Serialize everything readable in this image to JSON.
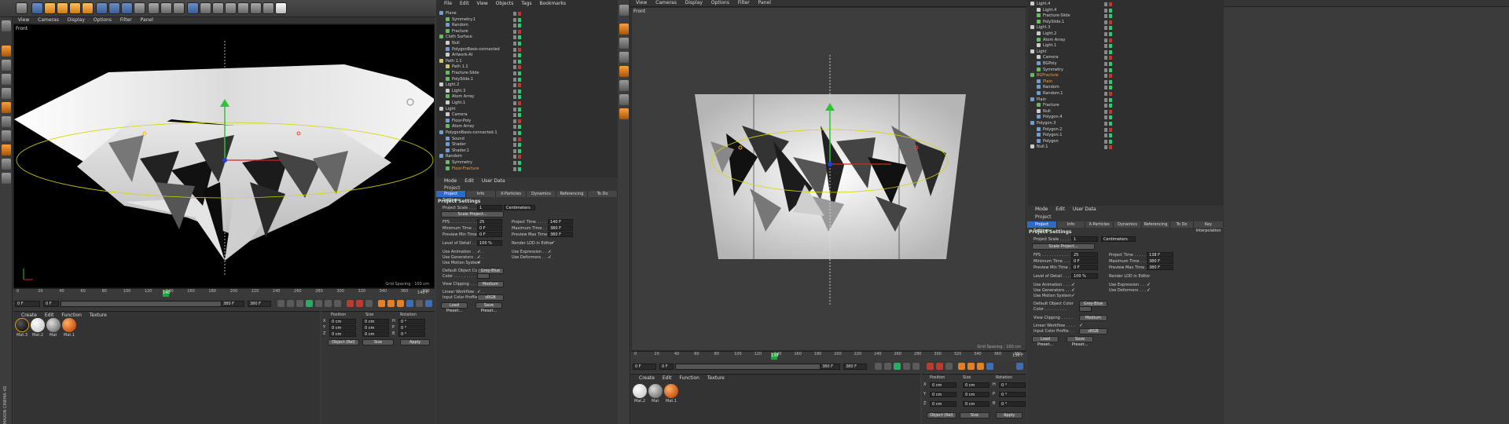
{
  "left": {
    "viewport_menu": [
      "View",
      "Cameras",
      "Display",
      "Options",
      "Filter",
      "Panel"
    ],
    "viewport_label": "Front",
    "grid_spacing": "Grid Spacing : 100 cm",
    "timeline_ticks": [
      "0",
      "20",
      "40",
      "60",
      "80",
      "100",
      "120",
      "140",
      "160",
      "180",
      "200",
      "220",
      "240",
      "260",
      "280",
      "300",
      "320",
      "340",
      "360",
      "380"
    ],
    "playhead": "140",
    "frame_end": "140 F",
    "frame_start_field": "0 F",
    "frame_min_field": "0 F",
    "frame_range_end": "380 F",
    "frame_max_field": "380 F",
    "objects_menu": [
      "File",
      "Edit",
      "View",
      "Objects",
      "Tags",
      "Bookmarks"
    ],
    "objects": [
      {
        "name": "Plane",
        "icon": "b",
        "orange": false
      },
      {
        "name": "Symmetry.1",
        "icon": "g",
        "orange": false
      },
      {
        "name": "Random",
        "icon": "b",
        "orange": false
      },
      {
        "name": "Fracture",
        "icon": "g",
        "orange": false
      },
      {
        "name": "Cloth Surface",
        "icon": "g",
        "orange": false
      },
      {
        "name": "Null",
        "icon": "w",
        "orange": false
      },
      {
        "name": "PolygonBasis-connected",
        "icon": "b",
        "orange": false
      },
      {
        "name": "Artwork-AI",
        "icon": "w",
        "orange": false
      },
      {
        "name": "Path 1.1",
        "icon": "y",
        "orange": false
      },
      {
        "name": "Path 1.1",
        "icon": "y",
        "orange": false
      },
      {
        "name": "Fracture-Slide",
        "icon": "g",
        "orange": false
      },
      {
        "name": "PolySlide.1",
        "icon": "g",
        "orange": false
      },
      {
        "name": "Light.2",
        "icon": "w",
        "orange": false
      },
      {
        "name": "Light.3",
        "icon": "w",
        "orange": false
      },
      {
        "name": "Atom Array",
        "icon": "g",
        "orange": false
      },
      {
        "name": "Light.1",
        "icon": "w",
        "orange": false
      },
      {
        "name": "Light",
        "icon": "w",
        "orange": false
      },
      {
        "name": "Camera",
        "icon": "w",
        "orange": false
      },
      {
        "name": "Floor-Poly",
        "icon": "b",
        "orange": false
      },
      {
        "name": "Atom Array",
        "icon": "g",
        "orange": false
      },
      {
        "name": "PolygonBasis-connected.1",
        "icon": "b",
        "orange": false
      },
      {
        "name": "Sound",
        "icon": "b",
        "orange": false
      },
      {
        "name": "Shader",
        "icon": "b",
        "orange": false
      },
      {
        "name": "Shader.1",
        "icon": "b",
        "orange": false
      },
      {
        "name": "Random",
        "icon": "b",
        "orange": false
      },
      {
        "name": "Symmetry",
        "icon": "g",
        "orange": false
      },
      {
        "name": "Floor-Fracture",
        "icon": "g",
        "orange": true
      }
    ],
    "attr_menu": [
      "Mode",
      "Edit",
      "User Data"
    ],
    "attr_title": "Project",
    "attr_tabs": [
      "Project Settings",
      "Info",
      "X-Particles",
      "Dynamics",
      "Referencing",
      "To Do"
    ],
    "section": "Project Settings",
    "project_scale_label": "Project Scale . . . . .",
    "project_scale_value": "1",
    "project_scale_unit": "Centimeters",
    "scale_project_btn": "Scale Project...",
    "fps_label": "FPS . . . . . . . . . . .",
    "fps": "25",
    "project_time_label": "Project Time . . . . .",
    "project_time": "140 F",
    "min_time_label": "Minimum Time . . . .",
    "min_time": "0 F",
    "max_time_label": "Maximum Time . . .",
    "max_time": "380 F",
    "pmin_label": "Preview Min Time . .",
    "pmin": "0 F",
    "pmax_label": "Preview Max Time .",
    "pmax": "380 F",
    "lod_label": "Level of Detail . . . .",
    "lod": "100 %",
    "render_lod_label": "Render LOD in Editor",
    "use_anim": "Use Animation . . . . .",
    "use_expr": "Use Expression . . . .",
    "use_gen": "Use Generators . . . .",
    "use_def": "Use Deformers . . . .",
    "use_motion": "Use Motion System",
    "def_obj_color_label": "Default Object Color",
    "def_obj_color": "Grey-Blue",
    "color_label": "Color . . . . . . . . .",
    "view_clip_label": "View Clipping . . . . .",
    "view_clip": "Medium",
    "linear_label": "Linear Workflow . . . .",
    "input_profile_label": "Input Color Profile . .",
    "input_profile": "sRGB",
    "load_preset": "Load Preset...",
    "save_preset": "Save Preset...",
    "mat_menu": [
      "Create",
      "Edit",
      "Function",
      "Texture"
    ],
    "materials": [
      "Mat.3",
      "Mat.2",
      "Mat",
      "Mat.1"
    ],
    "coord_headers": [
      "Position",
      "Size",
      "Rotation"
    ],
    "coord_rows": [
      {
        "axis": "X",
        "pos": "0 cm",
        "size": "0 cm",
        "rlab": "H",
        "rot": "0 °"
      },
      {
        "axis": "Y",
        "pos": "0 cm",
        "size": "0 cm",
        "rlab": "P",
        "rot": "0 °"
      },
      {
        "axis": "Z",
        "pos": "0 cm",
        "size": "0 cm",
        "rlab": "B",
        "rot": "0 °"
      }
    ],
    "coord_mode": "Object (Rel)",
    "coord_size": "Size",
    "apply": "Apply",
    "brand": "MAXON CINEMA 4D"
  },
  "right": {
    "viewport_menu": [
      "View",
      "Cameras",
      "Display",
      "Options",
      "Filter",
      "Panel"
    ],
    "viewport_label": "Front",
    "grid_spacing": "Grid Spacing : 100 cm",
    "timeline_ticks": [
      "0",
      "20",
      "40",
      "60",
      "80",
      "100",
      "120",
      "140",
      "160",
      "180",
      "200",
      "220",
      "240",
      "260",
      "280",
      "300",
      "320",
      "340",
      "360",
      "380"
    ],
    "playhead": "138",
    "frame_end": "138 F",
    "frame_start_field": "0 F",
    "frame_min_field": "0 F",
    "frame_range_end": "380 F",
    "frame_max_field": "380 F",
    "objects": [
      {
        "name": "Light.4",
        "icon": "w",
        "orange": false
      },
      {
        "name": "Light.4",
        "icon": "w",
        "orange": false
      },
      {
        "name": "Fracture-Slide",
        "icon": "g",
        "orange": false
      },
      {
        "name": "PolySlide.1",
        "icon": "g",
        "orange": false
      },
      {
        "name": "Light.3",
        "icon": "w",
        "orange": false
      },
      {
        "name": "Light.2",
        "icon": "w",
        "orange": false
      },
      {
        "name": "Atom Array",
        "icon": "g",
        "orange": false
      },
      {
        "name": "Light.1",
        "icon": "w",
        "orange": false
      },
      {
        "name": "Light",
        "icon": "w",
        "orange": false
      },
      {
        "name": "Camera",
        "icon": "w",
        "orange": false
      },
      {
        "name": "BGPoly",
        "icon": "b",
        "orange": false
      },
      {
        "name": "Symmetry",
        "icon": "g",
        "orange": false
      },
      {
        "name": "BGFracture",
        "icon": "g",
        "orange": true
      },
      {
        "name": "Plain",
        "icon": "b",
        "orange": true
      },
      {
        "name": "Random",
        "icon": "b",
        "orange": false
      },
      {
        "name": "Random.1",
        "icon": "b",
        "orange": false
      },
      {
        "name": "Plain",
        "icon": "b",
        "orange": false
      },
      {
        "name": "Fracture",
        "icon": "g",
        "orange": false
      },
      {
        "name": "Null",
        "icon": "w",
        "orange": false
      },
      {
        "name": "Polygon.4",
        "icon": "b",
        "orange": false
      },
      {
        "name": "Polygon.3",
        "icon": "b",
        "orange": false
      },
      {
        "name": "Polygon.2",
        "icon": "b",
        "orange": false
      },
      {
        "name": "Polygon.1",
        "icon": "b",
        "orange": false
      },
      {
        "name": "Polygon",
        "icon": "b",
        "orange": false
      },
      {
        "name": "Null.1",
        "icon": "w",
        "orange": false
      }
    ],
    "attr_menu": [
      "Mode",
      "Edit",
      "User Data"
    ],
    "attr_title": "Project",
    "attr_tabs": [
      "Project Settings",
      "Info",
      "X-Particles",
      "Dynamics",
      "Referencing",
      "To Do",
      "Key Interpolation"
    ],
    "section": "Project Settings",
    "project_scale_value": "1",
    "project_scale_unit": "Centimeters",
    "scale_project_btn": "Scale Project...",
    "fps": "25",
    "project_time": "138 F",
    "min_time": "0 F",
    "max_time": "380 F",
    "pmin": "0 F",
    "pmax": "380 F",
    "lod": "100 %",
    "def_obj_color": "Grey-Blue",
    "view_clip": "Medium",
    "input_profile": "sRGB",
    "load_preset": "Load Preset...",
    "save_preset": "Save Preset...",
    "mat_menu": [
      "Create",
      "Edit",
      "Function",
      "Texture"
    ],
    "materials": [
      "Mat.2",
      "Mat",
      "Mat.1"
    ],
    "coord_mode": "Object (Rel)",
    "coord_size": "Size",
    "apply": "Apply"
  }
}
